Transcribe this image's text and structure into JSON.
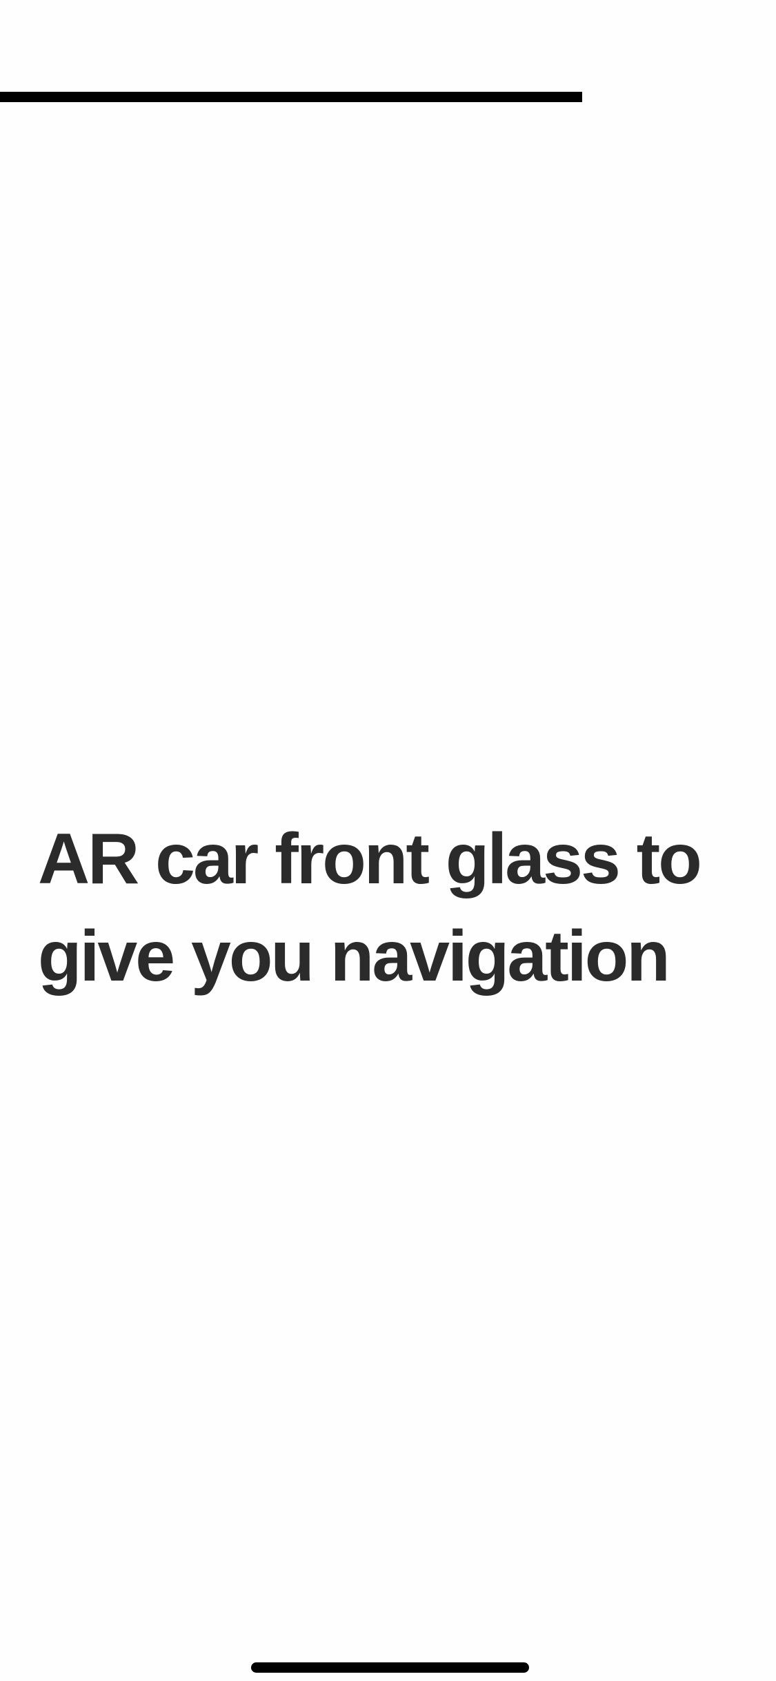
{
  "story": {
    "progress": 0.75,
    "headline": "AR car front glass to give you navigation"
  }
}
